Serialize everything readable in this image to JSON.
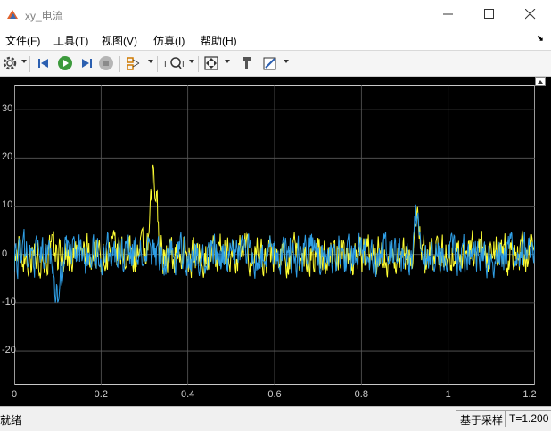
{
  "window": {
    "title": "xy_电流"
  },
  "menu": {
    "items": [
      "文件(F)",
      "工具(T)",
      "视图(V)",
      "仿真(I)",
      "帮助(H)"
    ],
    "arrow": "⬊"
  },
  "toolbar": {
    "icons": [
      "gear-icon",
      "step-back-icon",
      "run-icon",
      "step-forward-icon",
      "stop-icon",
      "highlight-icon",
      "zoom-icon",
      "fit-icon",
      "style-icon",
      "properties-icon"
    ]
  },
  "plot": {
    "background": "#000000",
    "series_colors": [
      "#ffff33",
      "#2f9fe6"
    ],
    "y_ticks": [
      "30",
      "20",
      "10",
      "0",
      "-10",
      "-20"
    ],
    "x_ticks": [
      "0",
      "0.2",
      "0.4",
      "0.6",
      "0.8",
      "1",
      "1.2"
    ]
  },
  "chart_data": {
    "type": "line",
    "title": "",
    "xlabel": "",
    "ylabel": "",
    "xlim": [
      0,
      1.2
    ],
    "ylim": [
      -27,
      35
    ],
    "grid": true,
    "series": [
      {
        "color": "#ffff33",
        "description_points": [
          {
            "x": 0.0,
            "y": 1
          },
          {
            "x": 0.1,
            "y": -3
          },
          {
            "x": 0.2,
            "y": 2
          },
          {
            "x": 0.3,
            "y": -1
          },
          {
            "x": 0.32,
            "y": 16
          },
          {
            "x": 0.33,
            "y": 6
          },
          {
            "x": 0.4,
            "y": 1
          },
          {
            "x": 0.6,
            "y": 2
          },
          {
            "x": 0.8,
            "y": 0
          },
          {
            "x": 0.93,
            "y": 8
          },
          {
            "x": 1.0,
            "y": -1
          },
          {
            "x": 1.2,
            "y": 2
          }
        ]
      },
      {
        "color": "#2f9fe6",
        "description_points": [
          {
            "x": 0.0,
            "y": -1
          },
          {
            "x": 0.1,
            "y": -11
          },
          {
            "x": 0.2,
            "y": 3
          },
          {
            "x": 0.3,
            "y": -2
          },
          {
            "x": 0.4,
            "y": 2
          },
          {
            "x": 0.6,
            "y": -1
          },
          {
            "x": 0.8,
            "y": 1
          },
          {
            "x": 0.93,
            "y": 10
          },
          {
            "x": 1.0,
            "y": -3
          },
          {
            "x": 1.2,
            "y": 1
          }
        ]
      }
    ]
  },
  "status": {
    "left": "就绪",
    "mode": "基于采样",
    "time": "T=1.200"
  }
}
